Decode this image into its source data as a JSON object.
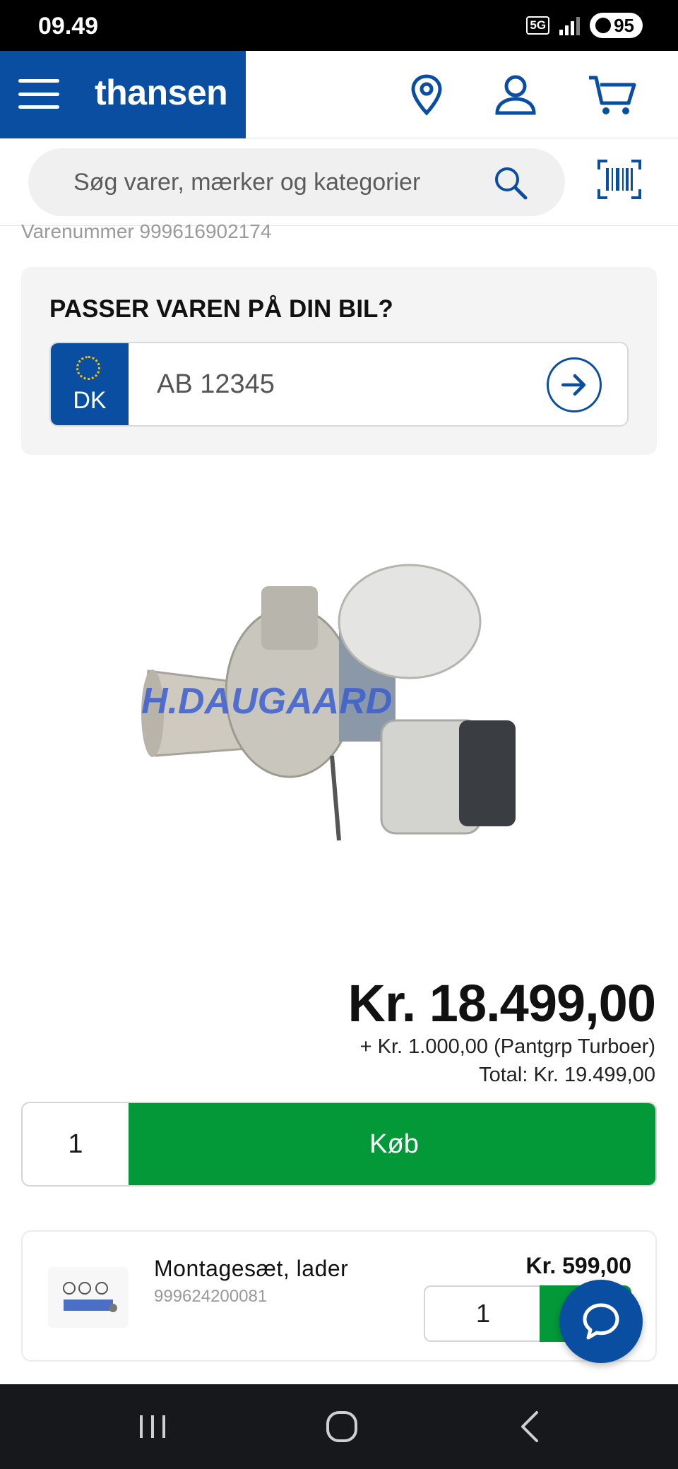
{
  "status_bar": {
    "time": "09.49",
    "network": "5G",
    "battery": "95"
  },
  "header": {
    "logo": "thansen"
  },
  "search": {
    "placeholder": "Søg varer, mærker og kategorier"
  },
  "product": {
    "item_number": "Varenummer 999616902174",
    "fitment_title": "PASSER VAREN PÅ DIN BIL?",
    "plate_country": "DK",
    "plate_placeholder": "AB 12345",
    "watermark": "H.DAUGAARD",
    "price": "Kr. 18.499,00",
    "deposit": "+ Kr. 1.000,00 (Pantgrp Turboer)",
    "total": "Total: Kr. 19.499,00",
    "quantity": "1",
    "buy_label": "Køb"
  },
  "accessory": {
    "name": "Montagesæt, lader",
    "sku": "999624200081",
    "price": "Kr. 599,00",
    "quantity": "1"
  },
  "colors": {
    "brand_blue": "#0a4ea1",
    "buy_green": "#039939"
  },
  "icons": [
    "menu-icon",
    "location-icon",
    "user-icon",
    "cart-icon",
    "search-icon",
    "barcode-icon",
    "arrow-right-icon",
    "chat-icon",
    "recents-icon",
    "home-icon",
    "back-icon"
  ]
}
